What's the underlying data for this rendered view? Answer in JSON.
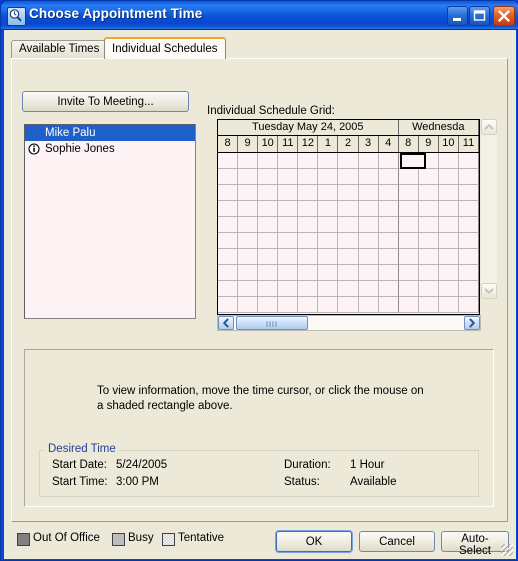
{
  "window": {
    "title": "Choose Appointment Time",
    "icon": "appointment-search-icon",
    "minimize_label": "Minimize",
    "maximize_label": "Maximize",
    "close_label": "Close"
  },
  "tabs": [
    {
      "label": "Available Times",
      "active": false
    },
    {
      "label": "Individual Schedules",
      "active": true
    }
  ],
  "left_panel": {
    "invite_button_label": "Invite To Meeting...",
    "attendees": [
      {
        "name": "Mike Palu",
        "selected": true,
        "icon": ""
      },
      {
        "name": "Sophie Jones",
        "selected": false,
        "icon": "info-icon"
      }
    ]
  },
  "grid": {
    "label": "Individual Schedule Grid:",
    "days": [
      {
        "label": "Tuesday May 24, 2005",
        "hours": [
          "8",
          "9",
          "10",
          "11",
          "12",
          "1",
          "2",
          "3",
          "4"
        ]
      },
      {
        "label": "Wednesda",
        "hours": [
          "8",
          "9",
          "10",
          "11"
        ]
      }
    ],
    "rows": 10,
    "time_cursor": {
      "day_index": 0,
      "hour_index": 7,
      "hour_label": "3",
      "row_index": 0
    },
    "cell_color": "#fdf3f5",
    "gridline_color": "#b9b5bb"
  },
  "info_panel": {
    "hint": "To view information, move the time cursor, or click the mouse on a shaded rectangle above.",
    "group_legend": "Desired Time",
    "fields": [
      {
        "label": "Start Date:",
        "value": "5/24/2005"
      },
      {
        "label": "Start Time:",
        "value": "3:00 PM"
      },
      {
        "label": "Duration:",
        "value": "1 Hour"
      },
      {
        "label": "Status:",
        "value": "Available"
      }
    ]
  },
  "legend": [
    {
      "label": "Out Of Office",
      "color": "#808080",
      "pattern": "solid"
    },
    {
      "label": "Busy",
      "color": "#bdbdbd",
      "pattern": "solid"
    },
    {
      "label": "Tentative",
      "color": "#ffffff",
      "pattern": "checker"
    }
  ],
  "buttons": {
    "ok": "OK",
    "cancel": "Cancel",
    "auto_select": "Auto-Select"
  },
  "colors": {
    "titlebar_blue": "#0a46d8",
    "dialog_face": "#ece9d8",
    "selection_blue": "#1e5fc8",
    "active_tab_accent": "#f0a732",
    "link_blue": "#21409a"
  }
}
